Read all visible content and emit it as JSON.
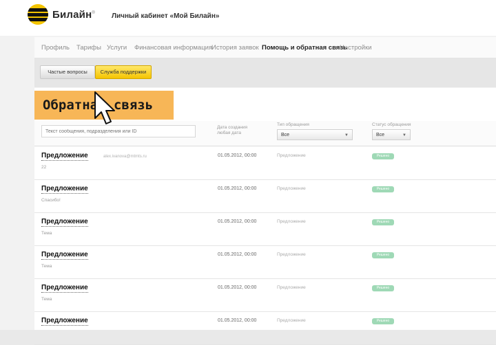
{
  "header": {
    "brand": "Билайн",
    "cabinet_title": "Личный кабинет «Мой Билайн»"
  },
  "nav": [
    {
      "label": "Профиль",
      "active": false
    },
    {
      "label": "Тарифы",
      "active": false
    },
    {
      "label": "Услуги",
      "active": false
    },
    {
      "label": "Финансовая информация",
      "active": false
    },
    {
      "label": "История заявок",
      "active": false
    },
    {
      "label": "Помощь и обратная связь",
      "active": true
    },
    {
      "label": "Настройки",
      "active": false
    }
  ],
  "subtabs": {
    "faq": "Частые вопросы",
    "support": "Служба поддержки"
  },
  "page_title": "Обратная связь",
  "filters": {
    "search_placeholder": "Текст сообщения, подразделения или ID",
    "date_label_line1": "Дата создания",
    "date_label_line2": "любая дата",
    "type_label": "Тип обращения",
    "type_value": "Все",
    "status_label": "Статус обращения",
    "status_value": "Все"
  },
  "rows": [
    {
      "title": "Предложение",
      "sub": "22",
      "email": "alex.ivanova@mtmts.ru",
      "date": "01.05.2012, 00:00",
      "type": "Предложение",
      "status": "Решено"
    },
    {
      "title": "Предложение",
      "sub": "Спасибо!",
      "email": "",
      "date": "01.05.2012, 00:00",
      "type": "Предложение",
      "status": "Решено"
    },
    {
      "title": "Предложение",
      "sub": "Тема",
      "email": "",
      "date": "01.05.2012, 00:00",
      "type": "Предложение",
      "status": "Решено"
    },
    {
      "title": "Предложение",
      "sub": "Тема",
      "email": "",
      "date": "01.05.2012, 00:00",
      "type": "Предложение",
      "status": "Решено"
    },
    {
      "title": "Предложение",
      "sub": "Тема",
      "email": "",
      "date": "01.05.2012, 00:00",
      "type": "Предложение",
      "status": "Решено"
    },
    {
      "title": "Предложение",
      "sub": "",
      "email": "",
      "date": "01.05.2012, 00:00",
      "type": "Предложение",
      "status": "Решено"
    }
  ],
  "colors": {
    "brand_yellow": "#f3c400",
    "title_band": "#f7b657",
    "status_green": "#9fd9b6"
  },
  "icons": {
    "logo": "beeline-logo-icon",
    "cursor": "mouse-pointer-icon",
    "dropdown": "chevron-down-icon"
  }
}
